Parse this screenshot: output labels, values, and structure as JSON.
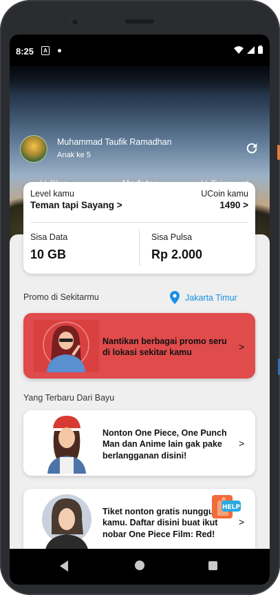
{
  "status_bar": {
    "time": "8:25",
    "notif_letter": "A"
  },
  "profile": {
    "name": "Muhammad Taufik Ramadhan",
    "subtitle": "Anak ke 5"
  },
  "tabs": [
    {
      "label": "U-Plan"
    },
    {
      "label": "Updates",
      "active": true
    },
    {
      "label": "U-Tainment"
    }
  ],
  "account": {
    "level_label": "Level kamu",
    "level_value": "Teman tapi Sayang >",
    "ucoin_label": "UCoin kamu",
    "ucoin_value": "1490 >",
    "data_label": "Sisa Data",
    "data_value": "10 GB",
    "pulsa_label": "Sisa Pulsa",
    "pulsa_value": "Rp 2.000"
  },
  "promo_section": {
    "title": "Promo di Sekitarmu",
    "location": "Jakarta Timur",
    "card_text": "Nantikan berbagai promo seru di lokasi sekitar kamu",
    "chevron": ">"
  },
  "updates_section": {
    "title": "Yang Terbaru Dari Bayu",
    "items": [
      {
        "text": "Nonton One Piece, One Punch Man dan Anime lain gak pake berlangganan disini!",
        "chevron": ">"
      },
      {
        "text": "Tiket nonton gratis nunggu kamu. Daftar disini buat ikut nobar One Piece Film: Red!",
        "chevron": ">"
      }
    ]
  },
  "help_button": {
    "label": "HELP"
  },
  "colors": {
    "accent": "#1a8fe3",
    "promo": "#e04b4b",
    "help": "#f26b3a"
  }
}
